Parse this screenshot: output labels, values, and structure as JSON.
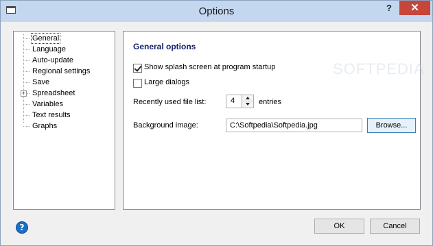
{
  "window": {
    "title": "Options",
    "help_glyph": "?",
    "close_glyph": "✕"
  },
  "tree": {
    "items": [
      {
        "label": "General",
        "selected": true,
        "expandable": false
      },
      {
        "label": "Language",
        "selected": false,
        "expandable": false
      },
      {
        "label": "Auto-update",
        "selected": false,
        "expandable": false
      },
      {
        "label": "Regional settings",
        "selected": false,
        "expandable": false
      },
      {
        "label": "Save",
        "selected": false,
        "expandable": false
      },
      {
        "label": "Spreadsheet",
        "selected": false,
        "expandable": true
      },
      {
        "label": "Variables",
        "selected": false,
        "expandable": false
      },
      {
        "label": "Text results",
        "selected": false,
        "expandable": false
      },
      {
        "label": "Graphs",
        "selected": false,
        "expandable": false
      }
    ],
    "expander_glyph": "+"
  },
  "general": {
    "section_title": "General options",
    "splash_label": "Show splash screen at program startup",
    "splash_checked": true,
    "large_dialogs_label": "Large dialogs",
    "large_dialogs_checked": false,
    "recent_label": "Recently used file list:",
    "recent_value": "4",
    "entries_label": "entries",
    "background_label": "Background image:",
    "background_value": "C:\\Softpedia\\Softpedia.jpg",
    "browse_label": "Browse..."
  },
  "footer": {
    "ok_label": "OK",
    "cancel_label": "Cancel",
    "help_icon_glyph": "?"
  },
  "watermark": "SOFTPEDIA",
  "colors": {
    "titlebar": "#c3d7ef",
    "close_button": "#c7463c",
    "section_title": "#12216e",
    "help_icon": "#1c6fc4"
  }
}
